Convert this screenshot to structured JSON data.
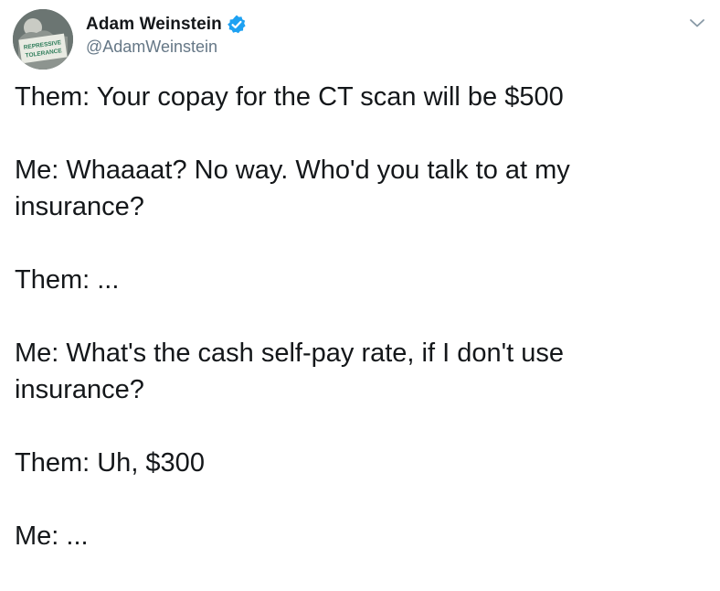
{
  "tweet": {
    "author": {
      "display_name": "Adam Weinstein",
      "handle": "@AdamWeinstein",
      "verified": true,
      "avatar_text_line1": "REPRESSIVE",
      "avatar_text_line2": "TOLERANCE"
    },
    "menu_icon": "chevron-down-icon",
    "paragraphs": [
      "Them: Your copay for the CT scan will be $500",
      "Me: Whaaaat? No way. Who'd you talk to at my\ninsurance?",
      "Them: ...",
      "Me: What's the cash self-pay rate, if I don't use\ninsurance?",
      "Them: Uh, $300",
      "Me: ..."
    ]
  },
  "colors": {
    "text_primary": "#14171a",
    "text_secondary": "#657786",
    "verified_blue": "#1da1f2"
  }
}
